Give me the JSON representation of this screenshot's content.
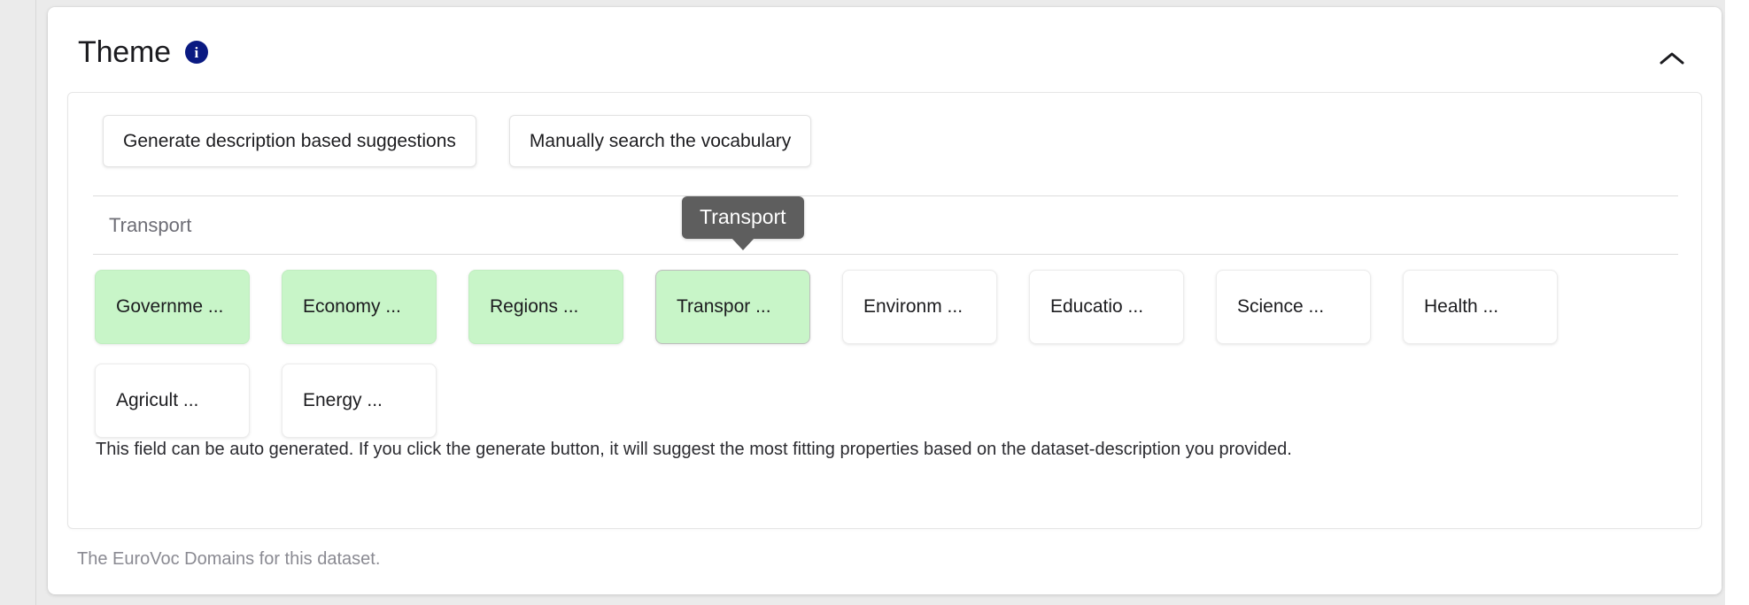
{
  "section": {
    "title": "Theme",
    "info_icon": "info-icon",
    "collapse_icon": "chevron-up-icon",
    "footer_note": "The EuroVoc Domains for this dataset."
  },
  "actions": [
    {
      "label": "Generate description based suggestions",
      "name": "generate-suggestions-button"
    },
    {
      "label": "Manually search the vocabulary",
      "name": "manual-search-button"
    }
  ],
  "search": {
    "value": "Transport",
    "placeholder": "Transport"
  },
  "tooltip": {
    "text": "Transport"
  },
  "chips": {
    "row1": [
      {
        "label": "Governme ...",
        "state": "selected"
      },
      {
        "label": "Economy ...",
        "state": "selected"
      },
      {
        "label": "Regions ...",
        "state": "selected"
      },
      {
        "label": "Transpor ...",
        "state": "hovered"
      },
      {
        "label": "Environm ...",
        "state": "default"
      },
      {
        "label": "Educatio ...",
        "state": "default"
      },
      {
        "label": "Science ...",
        "state": "default"
      },
      {
        "label": "Health ...",
        "state": "default"
      }
    ],
    "row2": [
      {
        "label": "Agricult ...",
        "state": "default"
      },
      {
        "label": "Energy ...",
        "state": "default"
      }
    ]
  },
  "helper_text": "This field can be auto generated. If you click the generate button, it will suggest the most fitting properties based on the dataset-description you provided."
}
